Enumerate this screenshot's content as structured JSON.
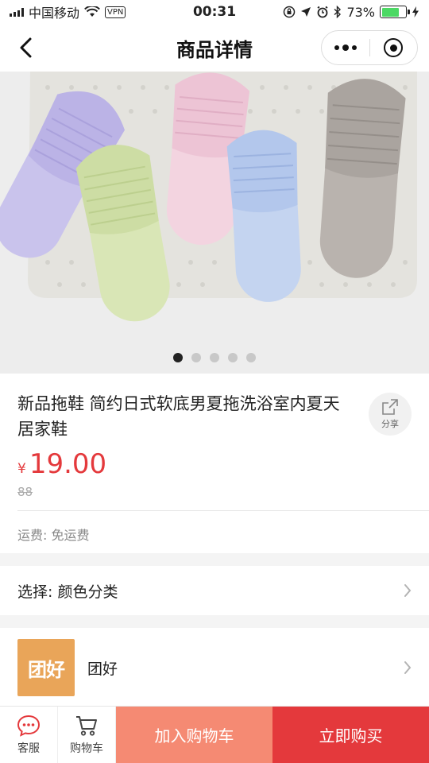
{
  "status_bar": {
    "carrier": "中国移动",
    "vpn": "VPN",
    "time": "00:31",
    "battery": "73%",
    "battery_level": 0.73
  },
  "nav": {
    "title": "商品详情"
  },
  "carousel": {
    "total": 5,
    "active_index": 0
  },
  "product": {
    "title": "新品拖鞋 简约日式软底男夏拖洗浴室内夏天居家鞋",
    "currency": "¥",
    "price": "19.00",
    "original_price": "88",
    "shipping": "运费: 免运费",
    "share_label": "分享"
  },
  "selection": {
    "label": "选择: 颜色分类"
  },
  "shop": {
    "logo_text": "团好",
    "name": "团好"
  },
  "bottom_bar": {
    "service_label": "客服",
    "cart_label": "购物车",
    "add_to_cart": "加入购物车",
    "buy_now": "立即购买"
  },
  "colors": {
    "price": "#e4393c",
    "add_to_cart_bg": "#f58a73",
    "buy_now_bg": "#e4393c",
    "service_icon": "#e4393c",
    "shop_logo_bg": "#e9a559"
  },
  "icons": {
    "back": "chevron-left-icon",
    "more": "more-dots-icon",
    "close": "target-circle-icon",
    "share": "share-icon",
    "chevron": "chevron-right-icon",
    "service": "chat-bubble-icon",
    "cart": "cart-icon"
  }
}
